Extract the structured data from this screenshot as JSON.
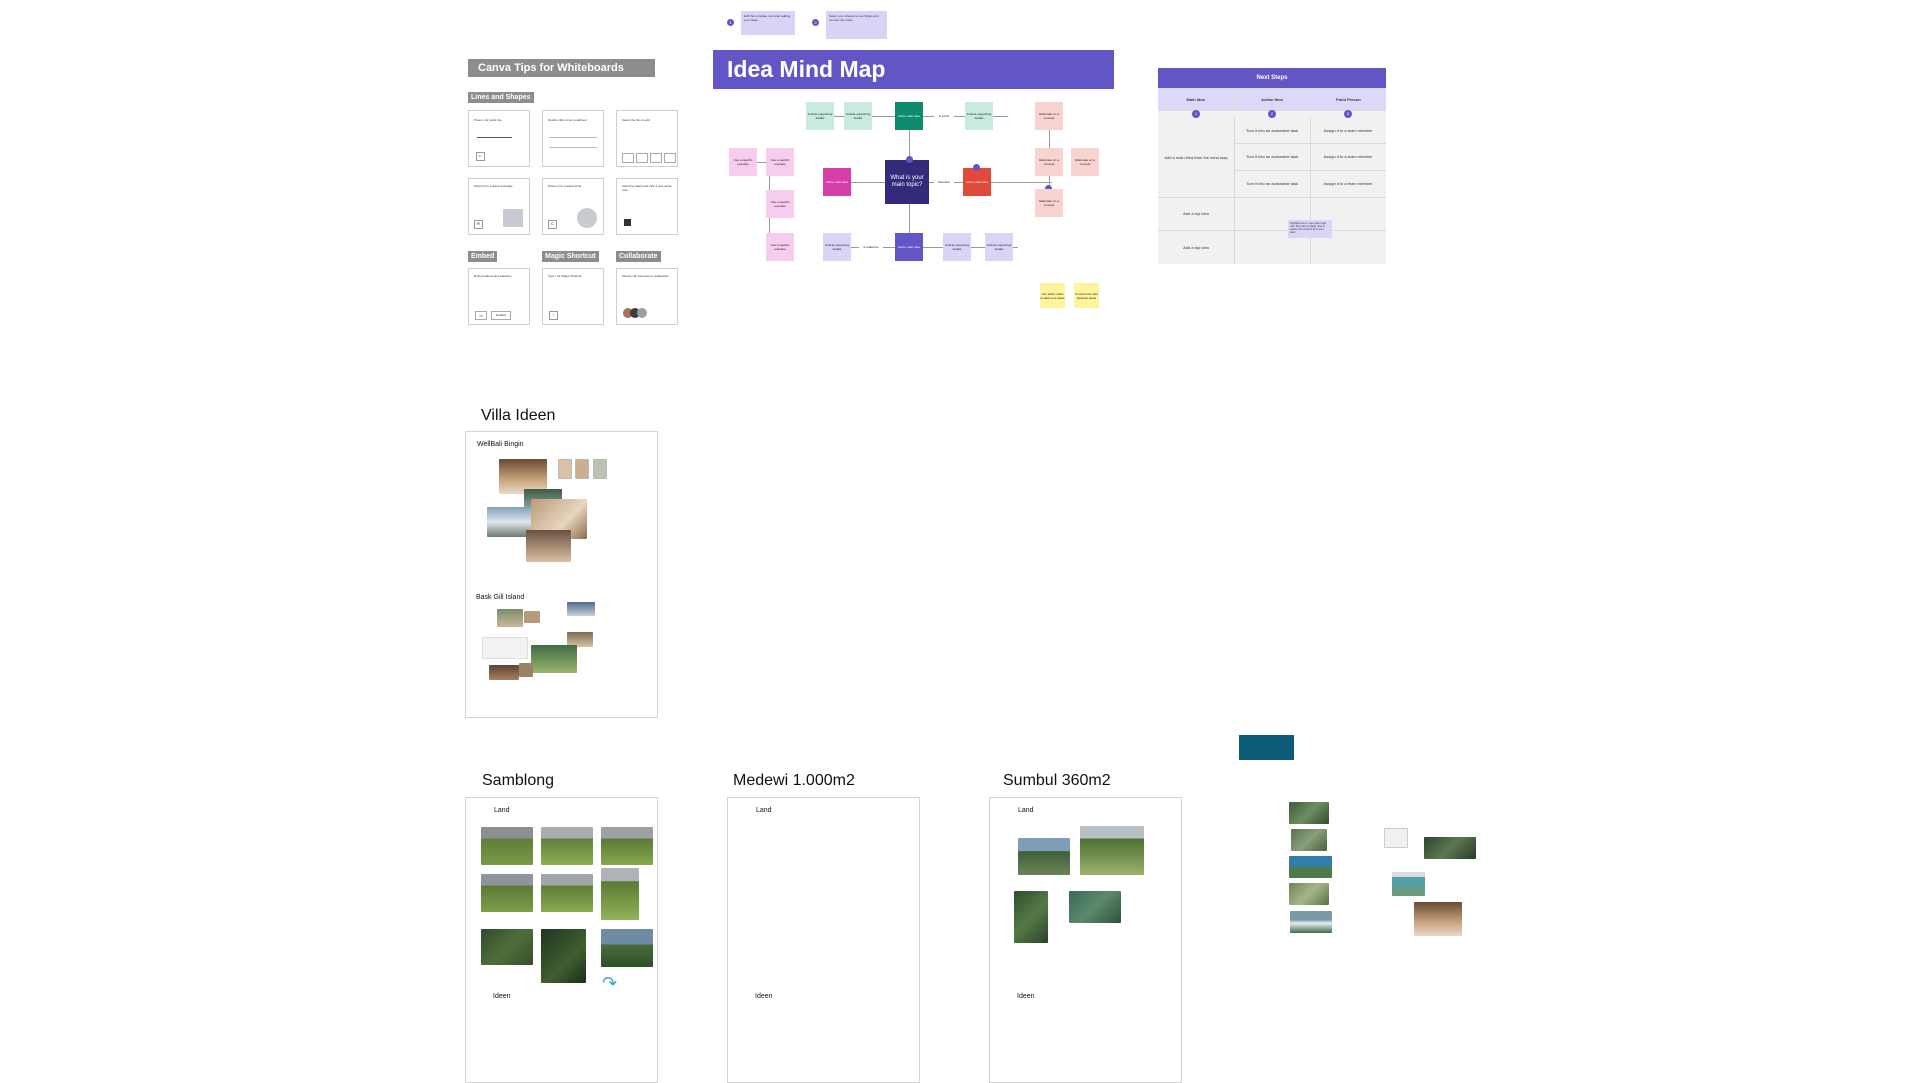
{
  "tips": {
    "title": "Canva Tips for Whiteboards",
    "sections": [
      "Lines and Shapes",
      "Embed",
      "Magic Shortcut",
      "Collaborate"
    ],
    "cards": [
      "Press L for quick line",
      "Double click a line to add text",
      "Select the line to edit",
      "Press R for a quick rectangle",
      "Press C for a quick circle",
      "Click the shape and pick a new sticky note",
      "Embed videos and websites",
      "Type / for Magic Shortcut",
      "Mention @ someone to collaborate"
    ],
    "key_r": "R",
    "key_c": "C",
    "embed_button": "Embed"
  },
  "hints": [
    {
      "num": "1",
      "text": "Edit this template, and start adding your ideas"
    },
    {
      "num": "2",
      "text": "Select your shapes to use Styles and connect the notes"
    }
  ],
  "mindmap": {
    "title": "Idea Mind Map",
    "center": "What is your main topic?",
    "main_idea": "Add a main idea",
    "main_idea_top": "Add a main idea",
    "main_idea_bottom": "Add a main idea",
    "main_idea_right": "Add a main idea",
    "supporting": "Include supporting details",
    "specific": "Use a specific example",
    "elaborate": "Elaborate on a concept",
    "connector_top": "is a fact",
    "connector_right": "therefore",
    "connector_bottom": "is related to",
    "sticky1": "Use sticky notes to add more ideas",
    "sticky2": "Connect the dots between ideas"
  },
  "next_steps": {
    "title": "Next Steps",
    "columns": [
      "Main Idea",
      "Action Item",
      "Point Person"
    ],
    "badges": [
      "1",
      "2",
      "3"
    ],
    "main_first": "Add a main idea from the mind map",
    "action": "Turn it into an actionable task",
    "person": "Assign it to a team member",
    "add_row": "Add a top idea",
    "note": "Highlight one or more plans right now, then rate by Magic Vote to capture the mood of all of your team"
  },
  "frames": {
    "villa": {
      "title": "Villa Ideen",
      "sub1": "WellBali Bingin",
      "sub2": "Bask Gili Island"
    },
    "samblong": {
      "title": "Samblong",
      "land": "Land",
      "ideen": "Ideen"
    },
    "medewi": {
      "title": "Medewi 1.000m2",
      "land": "Land",
      "ideen": "Ideen"
    },
    "sumbul": {
      "title": "Sumbul 360m2",
      "land": "Land",
      "ideen": "Ideen"
    }
  },
  "colors": {
    "mm_purple": "#6256c6",
    "mm_center": "#332a7c",
    "mm_green": "#0f8b6d",
    "mm_red": "#df4a3b",
    "mm_magenta": "#d63fa8",
    "teal_block": "#0c5b77"
  }
}
